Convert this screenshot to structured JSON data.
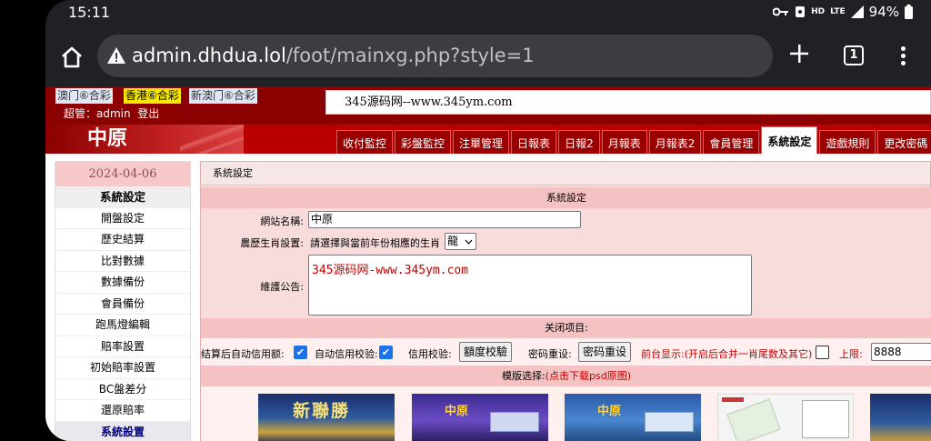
{
  "status_bar": {
    "time": "15:11",
    "hd": "HD",
    "lte": "LTE",
    "battery": "94%"
  },
  "browser": {
    "url_host": "admin.dhdua.lol",
    "url_path": "/foot/mainxg.php?style=1",
    "tab_count": "1"
  },
  "top": {
    "lottery_links": [
      "澳门⑥合彩",
      "香港⑥合彩",
      "新澳门⑥合彩"
    ],
    "admin_text": "超管：admin",
    "logout": "登出",
    "marquee": "345源码网--www.345ym.com"
  },
  "header": {
    "logo": "中原",
    "nav_tabs": [
      "收付監控",
      "彩盤監控",
      "注單管理",
      "日報表",
      "日報2",
      "月報表",
      "月報表2",
      "會員管理",
      "系統設定",
      "遊戲規則",
      "更改密碼"
    ],
    "active_tab": "系統設定"
  },
  "sidebar": {
    "date": "2024-04-06",
    "heading": "系統設定",
    "items": [
      "開盤設定",
      "歷史結算",
      "比對數據",
      "數據備份",
      "會員備份",
      "跑馬燈編輯",
      "賠率設置",
      "初始賠率設置",
      "BC盤差分",
      "還原賠率",
      "系統設置"
    ]
  },
  "main": {
    "breadcrumb": "系統設定",
    "section_title": "系統設定",
    "site_name_label": "網站名稱:",
    "site_name_value": "中原",
    "zodiac_label": "農歷生肖設置:",
    "zodiac_text": "請選擇與當前年份相應的生肖",
    "zodiac_value": "龍",
    "notice_label": "維護公告:",
    "notice_value": "345源码网-www.345ym.com",
    "close_items": "关闭项目:",
    "opt_auto_credit": "结算后自动信用额:",
    "opt_auto_check": "自动信用校验:",
    "opt_credit_check": "信用校验:",
    "btn_quota_check": "額度校驗",
    "opt_pwd_reset": "密码重设:",
    "btn_pwd_reset": "密码重设",
    "opt_front_display": "前台显示:(开启后合并一肖尾数及其它)",
    "opt_limit": "上限:",
    "limit_value": "8888",
    "template_label": "模版选择:",
    "template_link": "(点击下载psd原图)",
    "thumb_texts": [
      "新聯勝",
      "中原",
      "中原"
    ]
  }
}
